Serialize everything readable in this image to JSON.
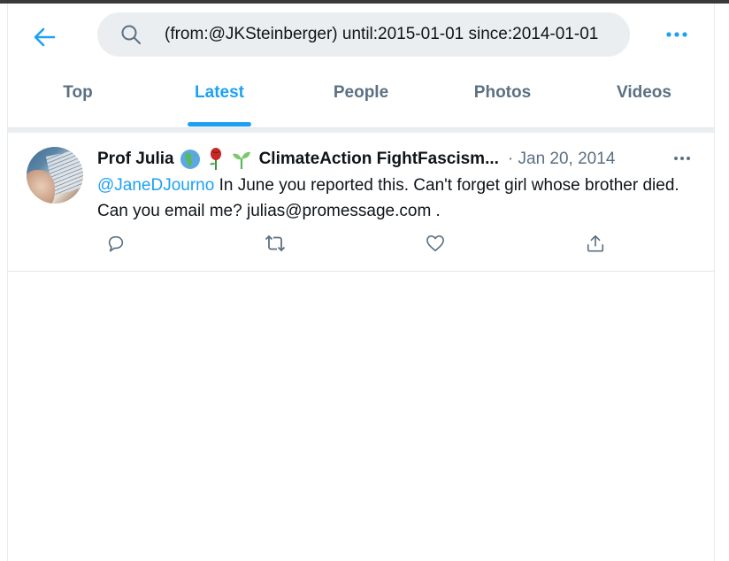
{
  "search": {
    "query": "(from:@JKSteinberger) until:2015-01-01 since:2014-01-01",
    "icon": "search-icon"
  },
  "nav": {
    "back_icon": "arrow-left-icon",
    "more_icon": "more-horizontal-icon"
  },
  "tabs": [
    {
      "label": "Top",
      "active": false
    },
    {
      "label": "Latest",
      "active": true
    },
    {
      "label": "People",
      "active": false
    },
    {
      "label": "Photos",
      "active": false
    },
    {
      "label": "Videos",
      "active": false
    }
  ],
  "tweet": {
    "author_name": "Prof Julia",
    "emojis": [
      "globe-africa-icon",
      "rose-icon",
      "seedling-icon"
    ],
    "author_name_rest": "ClimateAction FightFascism...",
    "date": "· Jan 20, 2014",
    "mention": "@JaneDJourno",
    "text": " In June you reported this. Can't forget girl whose brother died. Can you email me? julias@promessage.com .",
    "actions": [
      "reply-icon",
      "retweet-icon",
      "like-icon",
      "share-icon"
    ]
  },
  "colors": {
    "accent": "#1da1f2",
    "muted": "#5b7083",
    "text": "#0f1419",
    "search_bg": "#ebeef0"
  }
}
